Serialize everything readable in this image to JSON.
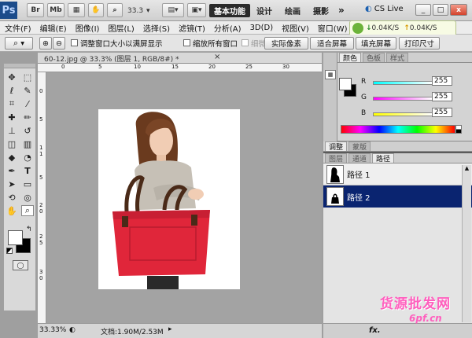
{
  "titlebar": {
    "app_logo": "Ps",
    "br_icon": "Br",
    "mb_icon": "Mb",
    "zoom": "33.3",
    "workspaces": [
      "基本功能",
      "设计",
      "绘画",
      "摄影"
    ],
    "more": "»",
    "cslive": "CS Live",
    "min": "_",
    "max": "□",
    "close": "x"
  },
  "menubar": {
    "items": [
      "文件(F)",
      "编辑(E)",
      "图像(I)",
      "图层(L)",
      "选择(S)",
      "滤镜(T)",
      "分析(A)",
      "3D(D)",
      "视图(V)",
      "窗口(W)",
      "帮助"
    ]
  },
  "speed": {
    "down": "0.04K/S",
    "up": "0.04K/S"
  },
  "options": {
    "resize_windows": "调整窗口大小以满屏显示",
    "zoom_all": "缩放所有窗口",
    "scrubby": "细微缩放",
    "actual_pixels": "实际像素",
    "fit_screen": "适合屏幕",
    "fill_screen": "填充屏幕",
    "print_size": "打印尺寸"
  },
  "document": {
    "tab_title": "60-12.jpg @ 33.3% (图层 1, RGB/8#) *",
    "close_x": "×",
    "zoom_level": "33.33%",
    "doc_info": "文档:1.90M/2.53M"
  },
  "ruler": {
    "top_ticks": [
      "0",
      "5",
      "10",
      "15",
      "20",
      "25",
      "30"
    ],
    "left_ticks": [
      "0",
      "5",
      "1",
      "1",
      "5",
      "2",
      "0",
      "2",
      "5",
      "3",
      "0"
    ]
  },
  "color_panel": {
    "tabs": [
      "颜色",
      "色板",
      "样式"
    ],
    "labels": [
      "R",
      "G",
      "B"
    ],
    "values": [
      "255",
      "255",
      "255"
    ],
    "colors": {
      "r": "#ff0000",
      "g": "#00ff00",
      "b": "#0000ff"
    }
  },
  "adjust_panel": {
    "tabs": [
      "调整",
      "蒙版"
    ]
  },
  "paths_panel": {
    "tabs": [
      "图层",
      "通道",
      "路径"
    ],
    "paths": [
      "路径 1",
      "路径 2"
    ],
    "selected_color": "#0a2470"
  },
  "watermark": {
    "main": "货源批发网",
    "url": "6pf.cn"
  }
}
